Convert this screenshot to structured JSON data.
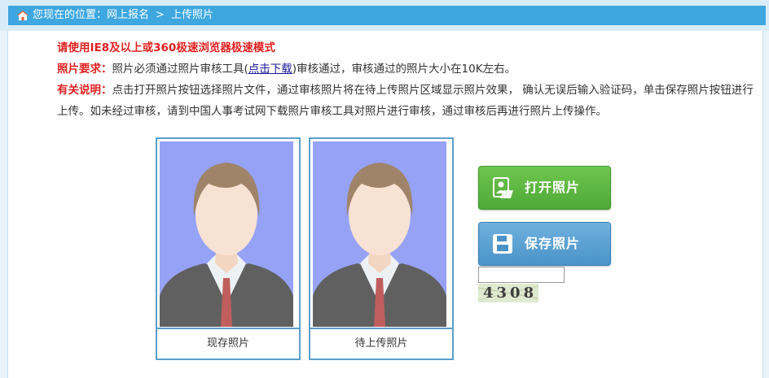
{
  "breadcrumb": {
    "prefix": "您现在的位置：",
    "items": [
      "网上报名",
      "上传照片"
    ],
    "separator": ">"
  },
  "notice": {
    "browser_tip": "请使用IE8及以上或360极速浏览器极速模式",
    "req_label": "照片要求：",
    "req_text_1": "照片必须通过照片审核工具(",
    "download_link": "点击下载",
    "req_text_2": ")审核通过，审核通过的照片大小在10K左右。",
    "info_label": "有关说明：",
    "info_text": "点击打开照片按钮选择照片文件，通过审核照片将在待上传照片区域显示照片效果， 确认无误后输入验证码，单击保存照片按钮进行上传。如未经过审核，请到中国人事考试网下载照片审核工具对照片进行审核，通过审核后再进行照片上传操作。"
  },
  "photos": {
    "current_caption": "现存照片",
    "pending_caption": "待上传照片"
  },
  "buttons": {
    "open_label": "打开照片",
    "save_label": "保存照片"
  },
  "captcha": {
    "value": "",
    "code": "4308"
  },
  "colors": {
    "header_bar": "#3ea7e0",
    "photo_bg": "#7f8ef3",
    "open_button": "#5bb843",
    "save_button": "#5aa2d4",
    "alert_red": "#e02020"
  },
  "icons": {
    "home": "home-icon",
    "open": "open-photo-icon",
    "save": "save-disk-icon"
  }
}
